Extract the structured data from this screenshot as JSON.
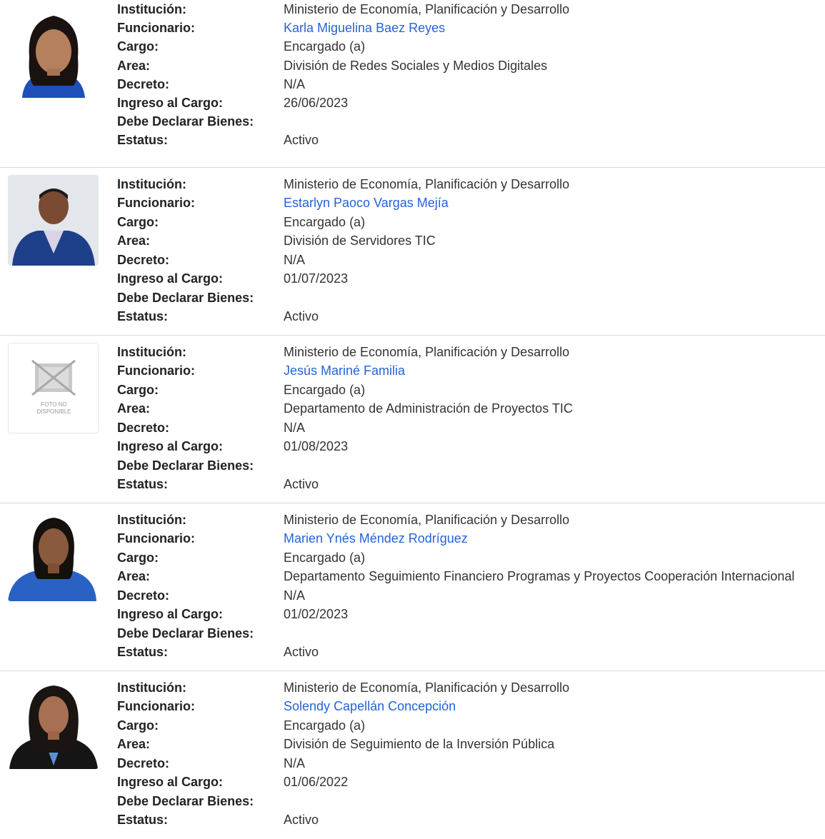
{
  "labels": {
    "institucion": "Institución:",
    "funcionario": "Funcionario:",
    "cargo": "Cargo:",
    "area": "Area:",
    "decreto": "Decreto:",
    "ingreso": "Ingreso al Cargo:",
    "declarar": "Debe Declarar Bienes:",
    "estatus": "Estatus:"
  },
  "photo_placeholder": {
    "line1": "FOTO NO",
    "line2": "DISPONIBLE"
  },
  "colors": {
    "link": "#2563d6",
    "separator": "#dcdcdc"
  },
  "records": [
    {
      "institucion": "Ministerio de Economía, Planificación y Desarrollo",
      "funcionario": "Karla Miguelina Baez Reyes",
      "cargo": "Encargado (a)",
      "area": "División de Redes Sociales y Medios Digitales",
      "decreto": "N/A",
      "ingreso": "26/06/2023",
      "declarar": "",
      "estatus": "Activo"
    },
    {
      "institucion": "Ministerio de Economía, Planificación y Desarrollo",
      "funcionario": "Estarlyn Paoco Vargas Mejía",
      "cargo": "Encargado (a)",
      "area": "División de Servidores TIC",
      "decreto": "N/A",
      "ingreso": "01/07/2023",
      "declarar": "",
      "estatus": "Activo"
    },
    {
      "institucion": "Ministerio de Economía, Planificación y Desarrollo",
      "funcionario": "Jesús Mariné Familia",
      "cargo": "Encargado (a)",
      "area": "Departamento de Administración de Proyectos TIC",
      "decreto": "N/A",
      "ingreso": "01/08/2023",
      "declarar": "",
      "estatus": "Activo"
    },
    {
      "institucion": "Ministerio de Economía, Planificación y Desarrollo",
      "funcionario": "Marien Ynés Méndez Rodríguez",
      "cargo": "Encargado (a)",
      "area": "Departamento Seguimiento Financiero Programas y Proyectos Cooperación Internacional",
      "decreto": "N/A",
      "ingreso": "01/02/2023",
      "declarar": "",
      "estatus": "Activo"
    },
    {
      "institucion": "Ministerio de Economía, Planificación y Desarrollo",
      "funcionario": "Solendy Capellán Concepción",
      "cargo": "Encargado (a)",
      "area": "División de Seguimiento de la Inversión Pública",
      "decreto": "N/A",
      "ingreso": "01/06/2022",
      "declarar": "",
      "estatus": "Activo"
    }
  ]
}
